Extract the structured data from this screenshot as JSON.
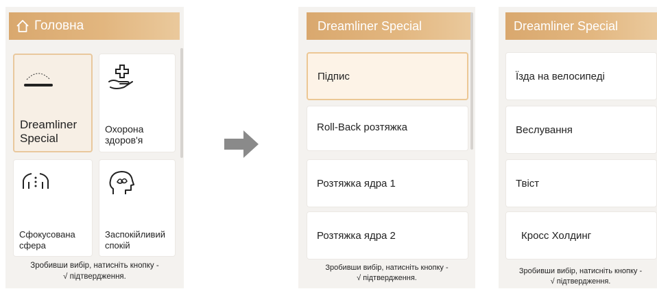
{
  "screen1": {
    "header": {
      "title": "Головна",
      "icon": "home-icon"
    },
    "tiles": [
      {
        "label": "Dreamliner\nSpecial",
        "icon": "mattress-icon",
        "selected": true
      },
      {
        "label": "Охорона\nздоров'я",
        "icon": "health-care-icon",
        "selected": false
      },
      {
        "label": "Сфокусована\nсфера",
        "icon": "focused-body-icon",
        "selected": false
      },
      {
        "label": "Заспокійливий\nспокій",
        "icon": "calm-head-icon",
        "selected": false
      }
    ],
    "footer_line1": "Зробивши вибір, натисніть кнопку -",
    "footer_line2": "√ підтвердження."
  },
  "screen2": {
    "header": {
      "title": "Dreamliner Special"
    },
    "items": [
      {
        "label": "Підпис",
        "selected": true
      },
      {
        "label": "Roll-Back розтяжка",
        "selected": false
      },
      {
        "label": "Розтяжка ядра 1",
        "selected": false
      },
      {
        "label": "Розтяжка ядра 2",
        "selected": false
      }
    ],
    "footer_line1": "Зробивши вибір, натисніть кнопку -",
    "footer_line2": "√ підтвердження."
  },
  "screen3": {
    "header": {
      "title": "Dreamliner Special"
    },
    "items": [
      {
        "label": "Їзда на велосипеді"
      },
      {
        "label": "Веслування"
      },
      {
        "label": "Твіст"
      },
      {
        "label": "Кросс Холдинг"
      }
    ],
    "footer_line1": "Зробивши вибір, натисніть кнопку -",
    "footer_line2": "√ підтвердження."
  },
  "colors": {
    "accent": "#dba96f",
    "selected_border": "#e9c89d",
    "arrow": "#8a8a8a"
  }
}
